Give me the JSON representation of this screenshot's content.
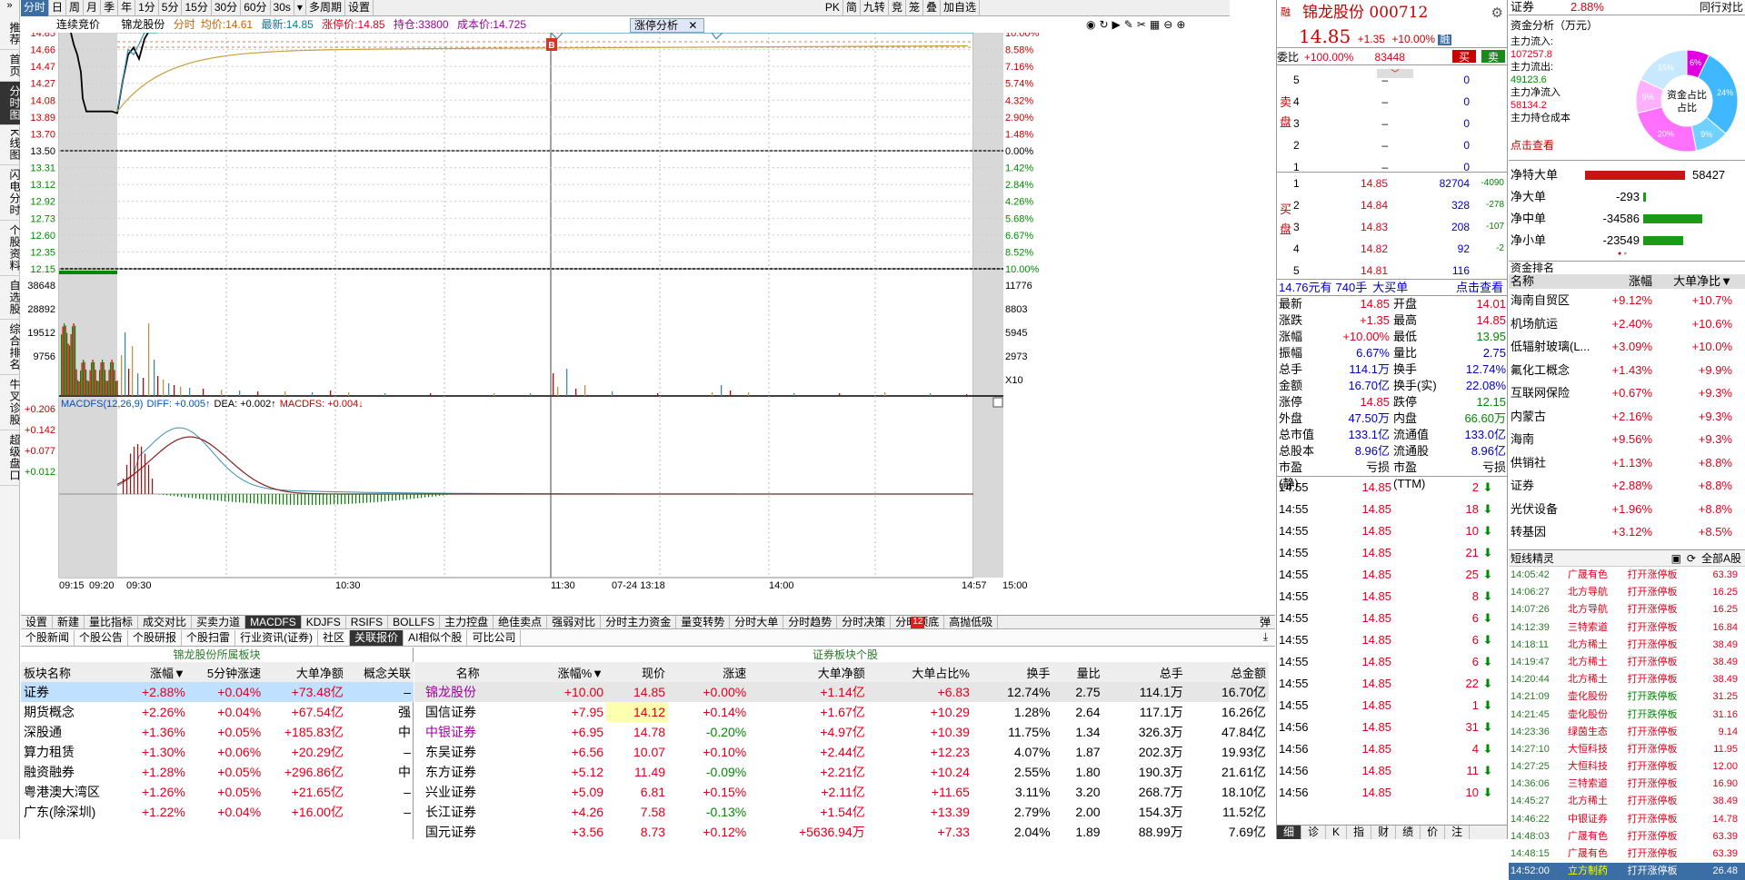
{
  "leftnav": [
    "推荐",
    "首页",
    "分时图",
    "K线图",
    "闪电分时",
    "个股资料",
    "自选股",
    "综合排名",
    "牛叉诊股",
    "超级盘口"
  ],
  "toolbar": {
    "items": [
      "分时",
      "日",
      "周",
      "月",
      "季",
      "年",
      "1分",
      "5分",
      "15分",
      "30分",
      "60分",
      "30s",
      "▾",
      "多周期",
      "设置"
    ],
    "right": [
      "PK",
      "简",
      "九转",
      "竞",
      "笼",
      "叠",
      "加自选"
    ]
  },
  "chart_header": {
    "auction": "连续竞价",
    "name": "锦龙股份",
    "label1": "分时",
    "avg_label": "均价:",
    "avg": "14.61",
    "last_label": "最新:",
    "last": "14.85",
    "limit_label": "涨停价:",
    "limit": "14.85",
    "pos_label": "持仓:",
    "pos": "33800",
    "cost_label": "成本价:",
    "cost": "14.725",
    "tag": "涨停分析"
  },
  "price_axis_left": [
    "14.85",
    "14.66",
    "14.47",
    "14.27",
    "14.08",
    "13.89",
    "13.70",
    "13.50",
    "13.31",
    "13.12",
    "12.92",
    "12.73",
    "12.60",
    "12.35",
    "12.15"
  ],
  "price_axis_right": [
    "10.00%",
    "8.58%",
    "7.16%",
    "5.74%",
    "4.32%",
    "2.90%",
    "1.48%",
    "0.00%",
    "1.42%",
    "2.84%",
    "4.26%",
    "5.68%",
    "6.67%",
    "8.52%",
    "10.00%"
  ],
  "vol_axis_left": [
    "38648",
    "28892",
    "19512",
    "9756"
  ],
  "vol_axis_right": [
    "11776",
    "8803",
    "5945",
    "2973",
    "X10"
  ],
  "macd": {
    "label": "MACDFS(12,26,9)",
    "diff": "DIFF: +0.005↑",
    "dea": "DEA: +0.002↑",
    "macdfs": "MACDFS: +0.004↓",
    "axis": [
      "+0.206",
      "+0.142",
      "+0.077",
      "+0.012"
    ]
  },
  "time_axis": [
    "09:15",
    "09:20",
    "09:30",
    "10:30",
    "11:30",
    "07-24 13:18",
    "14:00",
    "14:57",
    "15:00"
  ],
  "trade_marker": "B",
  "bottom_tabs": [
    "设置",
    "新建",
    "量比指标",
    "成交对比",
    "买卖力道",
    "MACDFS",
    "KDJFS",
    "RSIFS",
    "BOLLFS",
    "主力控盘",
    "绝佳卖点",
    "强弱对比",
    "分时主力资金",
    "量变转势",
    "分时大单",
    "分时趋势",
    "分时决策",
    "分时顶底",
    "高抛低吸"
  ],
  "bottom_tab_badge": "12",
  "switch_label": "弹",
  "sub_tabs": [
    "个股新闻",
    "个股公告",
    "个股研报",
    "个股扫雷",
    "行业资讯(证券)",
    "社区",
    "关联报价",
    "AI相似个股",
    "可比公司"
  ],
  "sector_table": {
    "title": "锦龙股份所属板块",
    "headers": [
      "板块名称",
      "涨幅▼",
      "5分钟涨速",
      "大单净额",
      "概念关联"
    ],
    "rows": [
      [
        "证券",
        "+2.88%",
        "+0.04%",
        "+73.48亿",
        "–"
      ],
      [
        "期货概念",
        "+2.26%",
        "+0.04%",
        "+67.54亿",
        "强"
      ],
      [
        "深股通",
        "+1.36%",
        "+0.05%",
        "+185.83亿",
        "中"
      ],
      [
        "算力租赁",
        "+1.30%",
        "+0.06%",
        "+20.29亿",
        "–"
      ],
      [
        "融资融券",
        "+1.28%",
        "+0.05%",
        "+296.86亿",
        "中"
      ],
      [
        "粤港澳大湾区",
        "+1.26%",
        "+0.05%",
        "+21.65亿",
        "–"
      ],
      [
        "广东(除深圳)",
        "+1.22%",
        "+0.04%",
        "+16.00亿",
        "–"
      ]
    ]
  },
  "stock_table": {
    "title": "证券板块个股",
    "headers": [
      "名称",
      "涨幅%▼",
      "现价",
      "涨速",
      "大单净额",
      "大单占比%",
      "换手",
      "量比",
      "总手",
      "总金额"
    ],
    "rows": [
      [
        "锦龙股份",
        "+10.00",
        "14.85",
        "+0.00%",
        "+1.14亿",
        "+6.83",
        "12.74%",
        "2.75",
        "114.1万",
        "16.70亿"
      ],
      [
        "国信证券",
        "+7.95",
        "14.12",
        "+0.14%",
        "+1.67亿",
        "+10.29",
        "1.28%",
        "2.64",
        "117.1万",
        "16.26亿"
      ],
      [
        "中银证券",
        "+6.95",
        "14.78",
        "-0.20%",
        "+4.97亿",
        "+10.39",
        "11.75%",
        "1.34",
        "326.3万",
        "47.84亿"
      ],
      [
        "东吴证券",
        "+6.56",
        "10.07",
        "+0.10%",
        "+2.44亿",
        "+12.23",
        "4.07%",
        "1.87",
        "202.3万",
        "19.93亿"
      ],
      [
        "东方证券",
        "+5.12",
        "11.49",
        "-0.09%",
        "+2.21亿",
        "+10.24",
        "2.55%",
        "1.80",
        "190.3万",
        "21.61亿"
      ],
      [
        "兴业证券",
        "+5.09",
        "6.81",
        "+0.15%",
        "+2.11亿",
        "+11.65",
        "3.11%",
        "3.20",
        "268.7万",
        "18.10亿"
      ],
      [
        "长江证券",
        "+4.26",
        "7.58",
        "-0.13%",
        "+1.54亿",
        "+13.39",
        "2.79%",
        "2.00",
        "154.3万",
        "11.52亿"
      ],
      [
        "国元证券",
        "+3.56",
        "8.73",
        "+0.12%",
        "+5636.94万",
        "+7.33",
        "2.04%",
        "1.89",
        "88.99万",
        "7.69亿"
      ]
    ]
  },
  "quote": {
    "name": "锦龙股份",
    "code": "000712",
    "price": "14.85",
    "chg": "+1.35",
    "pct": "+10.00%",
    "badge": "融",
    "wb_label": "委比",
    "wb": "+100.00%",
    "wc": "83448",
    "btn_buy": "买",
    "btn_sell": "卖",
    "sell_label": "卖盘",
    "buy_label": "买盘",
    "asks": [
      [
        "5",
        "–",
        "0"
      ],
      [
        "4",
        "–",
        "0"
      ],
      [
        "3",
        "–",
        "0"
      ],
      [
        "2",
        "–",
        "0"
      ],
      [
        "1",
        "–",
        "0"
      ]
    ],
    "bids": [
      [
        "1",
        "14.85",
        "82704",
        "-4090"
      ],
      [
        "2",
        "14.84",
        "328",
        "-278"
      ],
      [
        "3",
        "14.83",
        "208",
        "-107"
      ],
      [
        "4",
        "14.82",
        "92",
        "-2"
      ],
      [
        "5",
        "14.81",
        "116",
        ""
      ]
    ],
    "bigbuy": {
      "price": "14.76元有",
      "vol": "740手",
      "label": "大买单",
      "link": "点击查看"
    },
    "stats": [
      [
        "最新",
        "14.85",
        "开盘",
        "14.01"
      ],
      [
        "涨跌",
        "+1.35",
        "最高",
        "14.85"
      ],
      [
        "涨幅",
        "+10.00%",
        "最低",
        "13.95"
      ],
      [
        "振幅",
        "6.67%",
        "量比",
        "2.75"
      ],
      [
        "总手",
        "114.1万",
        "换手",
        "12.74%"
      ],
      [
        "金额",
        "16.70亿",
        "换手(实)",
        "22.08%"
      ],
      [
        "涨停",
        "14.85",
        "跌停",
        "12.15"
      ],
      [
        "外盘",
        "47.50万",
        "内盘",
        "66.60万"
      ],
      [
        "总市值",
        "133.1亿",
        "流通值",
        "133.0亿"
      ],
      [
        "总股本",
        "8.96亿",
        "流通股",
        "8.96亿"
      ],
      [
        "市盈(静)",
        "亏损",
        "市盈(TTM)",
        "亏损"
      ]
    ],
    "ticks": [
      [
        "14:55",
        "14.85",
        "2"
      ],
      [
        "14:55",
        "14.85",
        "18"
      ],
      [
        "14:55",
        "14.85",
        "10"
      ],
      [
        "14:55",
        "14.85",
        "21"
      ],
      [
        "14:55",
        "14.85",
        "25"
      ],
      [
        "14:55",
        "14.85",
        "8"
      ],
      [
        "14:55",
        "14.85",
        "6"
      ],
      [
        "14:55",
        "14.85",
        "6"
      ],
      [
        "14:55",
        "14.85",
        "6"
      ],
      [
        "14:55",
        "14.85",
        "22"
      ],
      [
        "14:55",
        "14.85",
        "1"
      ],
      [
        "14:56",
        "14.85",
        "31"
      ],
      [
        "14:56",
        "14.85",
        "4"
      ],
      [
        "14:56",
        "14.85",
        "11"
      ],
      [
        "14:56",
        "14.85",
        "10"
      ]
    ],
    "tabs": [
      "细",
      "诊",
      "K",
      "指",
      "财",
      "绩",
      "价",
      "注"
    ]
  },
  "fund": {
    "sector_label": "证券",
    "sector_pct": "2.88%",
    "peer": "同行对比",
    "title": "资金分析（万元）",
    "flows": [
      [
        "主力流入:",
        "107257.8"
      ],
      [
        "主力流出:",
        "49123.6"
      ],
      [
        "主力净流入",
        "58134.2"
      ],
      [
        "主力持仓成本",
        ""
      ]
    ],
    "flow_link": "点击查看",
    "donut_label": "资金占比",
    "donut_vals": [
      "6%",
      "24%",
      "9%",
      "20%",
      "9%",
      "15%"
    ],
    "net": [
      [
        "净特大单",
        "58427"
      ],
      [
        "净大单",
        "-293"
      ],
      [
        "净中单",
        "-34586"
      ],
      [
        "净小单",
        "-23549"
      ]
    ],
    "rank_title": "资金排名",
    "rank_headers": [
      "名称",
      "涨幅",
      "大单净比▼"
    ],
    "rank": [
      [
        "海南自贸区",
        "+9.12%",
        "+10.7%"
      ],
      [
        "机场航运",
        "+2.40%",
        "+10.6%"
      ],
      [
        "低辐射玻璃(L...",
        "+3.09%",
        "+10.0%"
      ],
      [
        "氟化工概念",
        "+1.43%",
        "+9.9%"
      ],
      [
        "互联网保险",
        "+0.67%",
        "+9.3%"
      ],
      [
        "内蒙古",
        "+2.16%",
        "+9.3%"
      ],
      [
        "海南",
        "+9.56%",
        "+9.3%"
      ],
      [
        "供销社",
        "+1.13%",
        "+8.8%"
      ],
      [
        "证券",
        "+2.88%",
        "+8.8%"
      ],
      [
        "光伏设备",
        "+1.96%",
        "+8.8%"
      ],
      [
        "转基因",
        "+3.12%",
        "+8.5%"
      ]
    ],
    "short_title": "短线精灵",
    "short_filter": "全部A股",
    "short": [
      [
        "14:05:42",
        "广晟有色",
        "打开涨停板",
        "63.39"
      ],
      [
        "14:06:27",
        "北方导航",
        "打开涨停板",
        "16.25"
      ],
      [
        "14:07:26",
        "北方导航",
        "打开涨停板",
        "16.25"
      ],
      [
        "14:12:39",
        "三特索道",
        "打开涨停板",
        "16.84"
      ],
      [
        "14:18:11",
        "北方稀土",
        "打开涨停板",
        "38.49"
      ],
      [
        "14:19:47",
        "北方稀土",
        "打开涨停板",
        "38.49"
      ],
      [
        "14:20:44",
        "北方稀土",
        "打开涨停板",
        "38.49"
      ],
      [
        "14:21:09",
        "壶化股份",
        "打开跌停板",
        "31.25"
      ],
      [
        "14:21:45",
        "壶化股份",
        "打开跌停板",
        "31.16"
      ],
      [
        "14:23:36",
        "绿茵生态",
        "打开涨停板",
        "9.14"
      ],
      [
        "14:27:10",
        "大恒科技",
        "打开涨停板",
        "11.95"
      ],
      [
        "14:27:25",
        "大恒科技",
        "打开涨停板",
        "12.00"
      ],
      [
        "14:36:06",
        "三特索道",
        "打开涨停板",
        "16.90"
      ],
      [
        "14:45:27",
        "北方稀土",
        "打开涨停板",
        "38.49"
      ],
      [
        "14:46:22",
        "中银证券",
        "打开涨停板",
        "14.78"
      ],
      [
        "14:48:03",
        "广晟有色",
        "打开涨停板",
        "63.39"
      ],
      [
        "14:48:15",
        "广晟有色",
        "打开涨停板",
        "63.39"
      ],
      [
        "14:52:00",
        "立方制药",
        "打开涨停板",
        "26.48"
      ]
    ]
  }
}
